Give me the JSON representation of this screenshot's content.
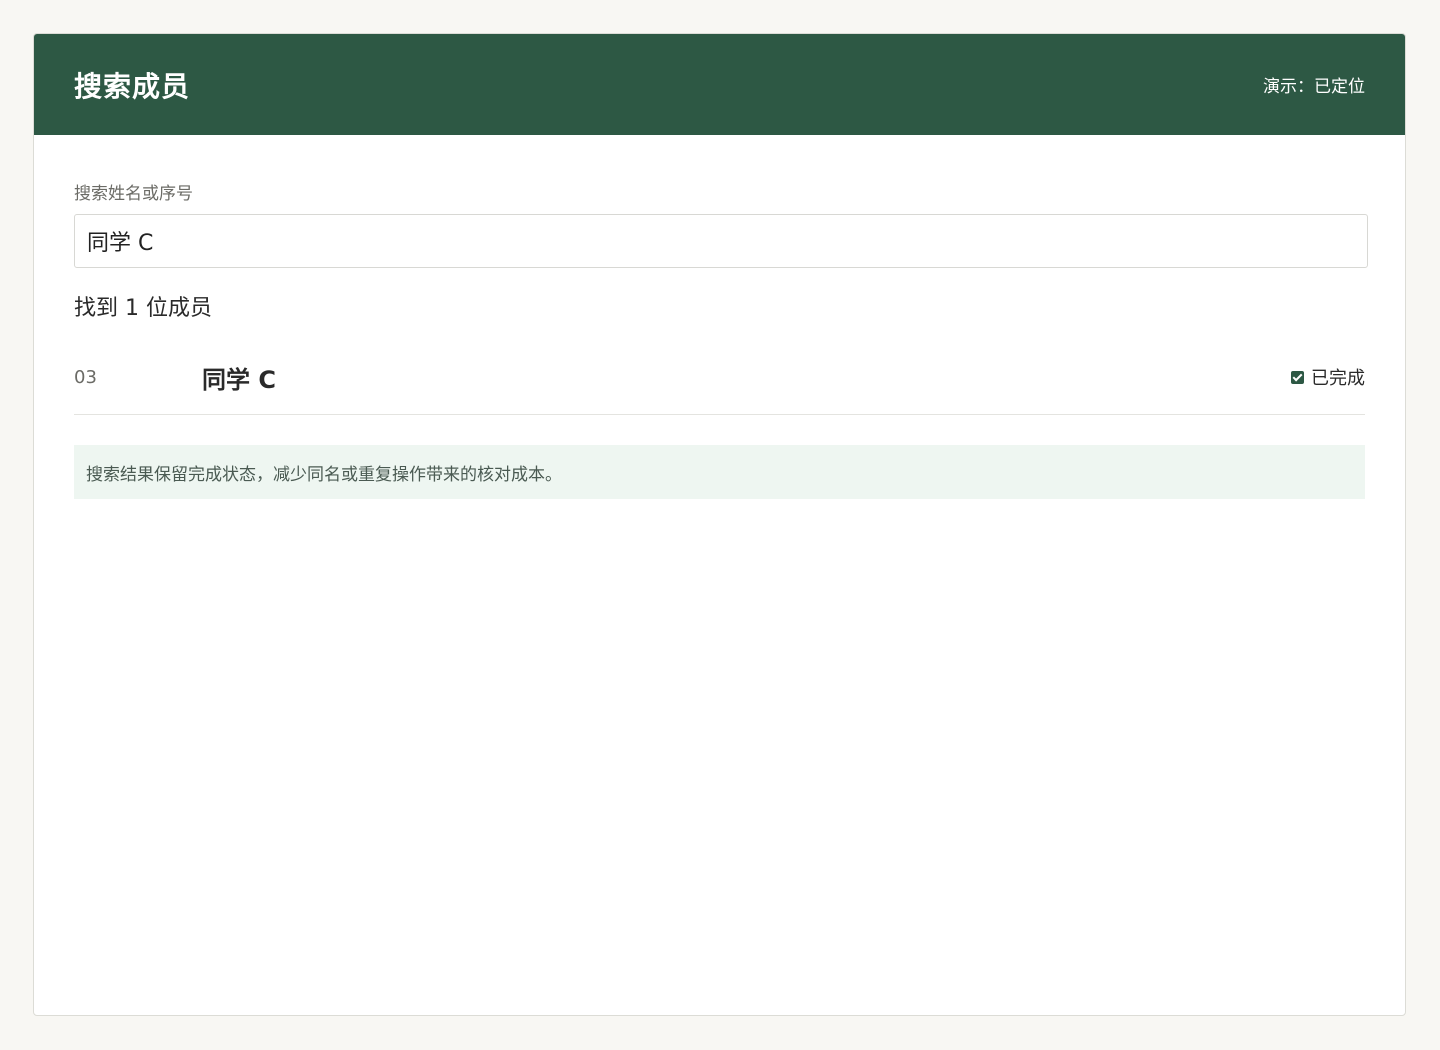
{
  "header": {
    "title": "搜索成员",
    "demo_status": "演示：已定位"
  },
  "search": {
    "label": "搜索姓名或序号",
    "value": "同学 C"
  },
  "results": {
    "count_text": "找到 1 位成员",
    "members": [
      {
        "index": "03",
        "name": "同学 C",
        "status": "已完成",
        "completed": true
      }
    ]
  },
  "note": {
    "text": "搜索结果保留完成状态，减少同名或重复操作带来的核对成本。"
  },
  "colors": {
    "header_bg": "#2d5844",
    "note_bg": "#eef6f1",
    "page_bg": "#f8f7f3"
  }
}
